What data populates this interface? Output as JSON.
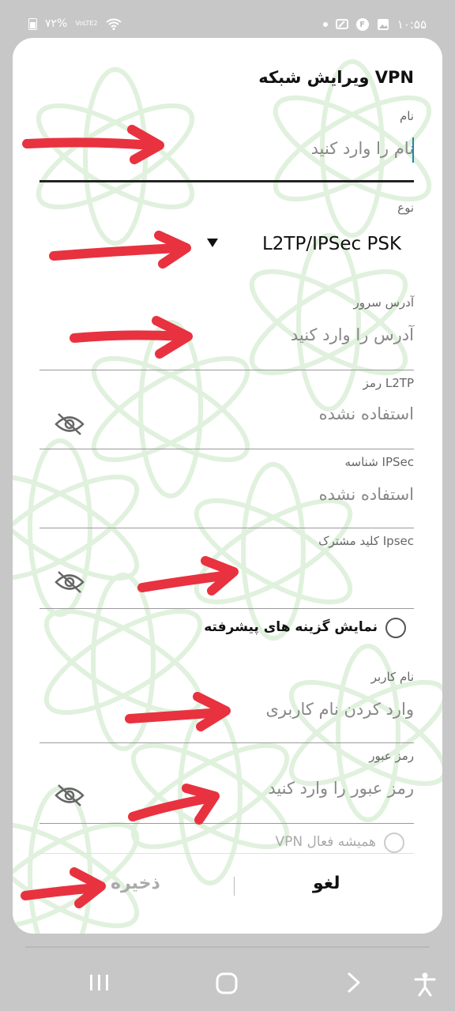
{
  "status_bar": {
    "battery": "٧٢%",
    "network": "VoLTE2",
    "time": "۱۰:۵۵",
    "notif_badge": "F"
  },
  "dialog": {
    "title": "ویرایش شبکه VPN",
    "name": {
      "label": "نام",
      "placeholder": "نام را وارد کنید"
    },
    "type": {
      "label": "نوع",
      "value": "L2TP/IPSec PSK"
    },
    "server": {
      "label": "آدرس سرور",
      "placeholder": "آدرس را وارد کنید"
    },
    "l2tp_secret": {
      "label": "رمز L2TP",
      "placeholder": "استفاده نشده"
    },
    "ipsec_id": {
      "label": "شناسه IPSec",
      "placeholder": "استفاده نشده"
    },
    "ipsec_psk": {
      "label": "کلید مشترک Ipsec",
      "placeholder": ""
    },
    "advanced": {
      "label": "نمایش گزینه های پیشرفته"
    },
    "username": {
      "label": "نام کاربر",
      "placeholder": "وارد کردن نام کاربری"
    },
    "password": {
      "label": "رمز عبور",
      "placeholder": "رمز عبور را وارد کنید"
    },
    "always_on": {
      "label": "VPN همیشه فعال"
    },
    "buttons": {
      "save": "ذخیره",
      "cancel": "لغو"
    }
  },
  "colors": {
    "arrow": "#e8323f",
    "accent_caret": "#1e88a8",
    "watermark": "#d6ecd2"
  }
}
